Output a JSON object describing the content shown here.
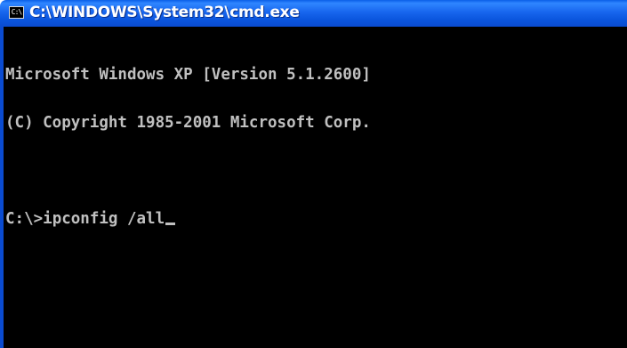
{
  "window": {
    "title": "C:\\WINDOWS\\System32\\cmd.exe",
    "icon": "cmd-console-icon",
    "icon_label": "C:\\"
  },
  "console": {
    "lines": [
      "Microsoft Windows XP [Version 5.1.2600]",
      "(C) Copyright 1985-2001 Microsoft Corp.",
      ""
    ],
    "prompt": "C:\\>",
    "command": "ipconfig /all",
    "text_color": "#c0c0c0",
    "background_color": "#000000"
  },
  "colors": {
    "titlebar": "#0a55dd",
    "frame": "#0a4bd0"
  }
}
